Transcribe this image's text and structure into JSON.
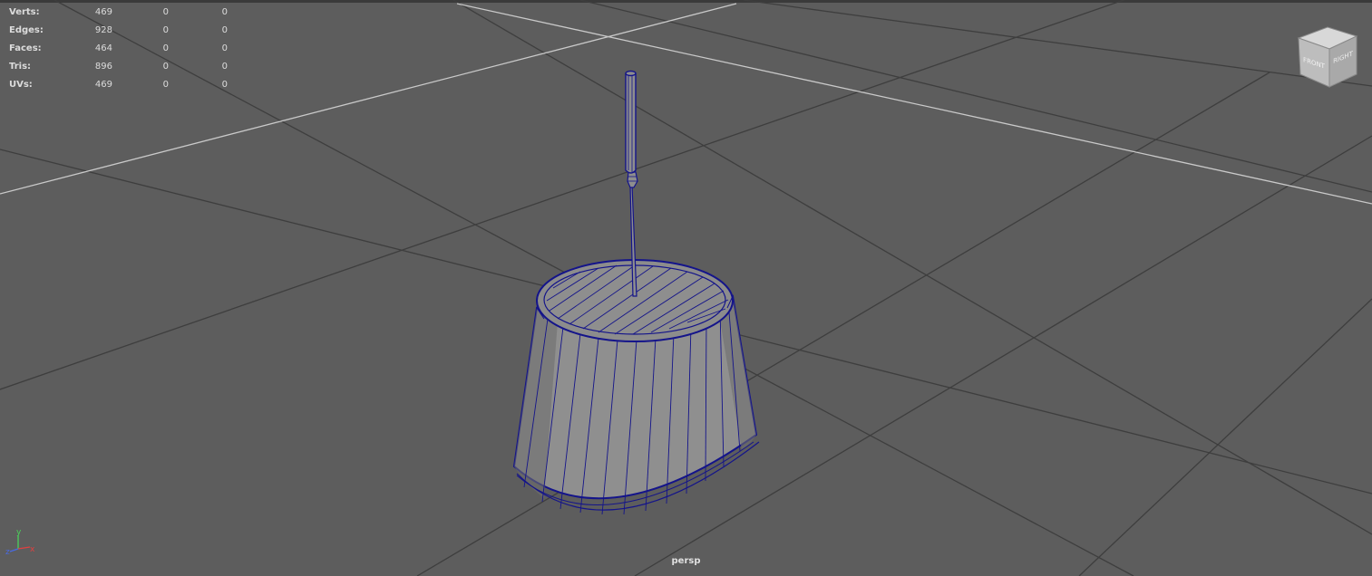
{
  "hud": {
    "rows": [
      {
        "label": "Verts:",
        "v1": "469",
        "v2": "0",
        "v3": "0"
      },
      {
        "label": "Edges:",
        "v1": "928",
        "v2": "0",
        "v3": "0"
      },
      {
        "label": "Faces:",
        "v1": "464",
        "v2": "0",
        "v3": "0"
      },
      {
        "label": "Tris:",
        "v1": "896",
        "v2": "0",
        "v3": "0"
      },
      {
        "label": "UVs:",
        "v1": "469",
        "v2": "0",
        "v3": "0"
      }
    ]
  },
  "viewport": {
    "camera": "persp",
    "background": "#5d5d5d",
    "wire_color": "#14148a",
    "mesh_color": "#8e8e8e"
  },
  "viewcube": {
    "front_label": "FRONT",
    "right_label": "RIGHT"
  },
  "axes": {
    "x": "x",
    "y": "y",
    "z": "z"
  }
}
